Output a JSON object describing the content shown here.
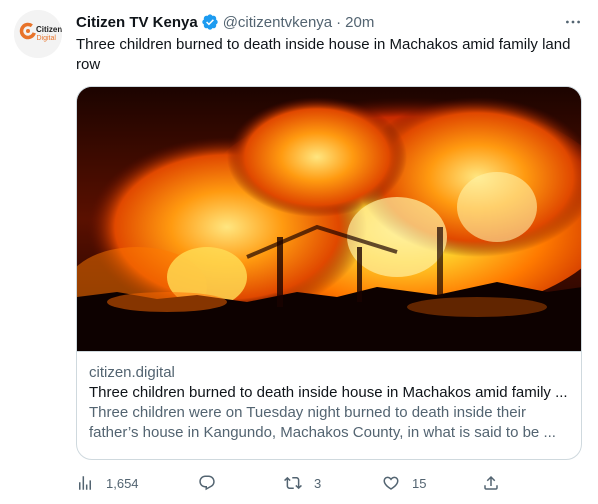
{
  "tweet": {
    "display_name": "Citizen TV Kenya",
    "handle": "@citizentvkenya",
    "separator": "·",
    "time": "20m",
    "text": "Three children burned to death inside house in Machakos amid family land row",
    "avatar": {
      "brand_text_line1": "Citizen",
      "brand_text_line2": "Digital",
      "brand_color": "#e8732a"
    },
    "verified_color": "#1d9bf0",
    "more_icon": "more-horizontal-icon"
  },
  "card": {
    "image_icon": "house-fire-photo",
    "domain": "citizen.digital",
    "title": "Three children burned to death inside house in Machakos amid family ...",
    "description": "Three children were on Tuesday night burned to death inside their father’s house in Kangundo, Machakos County, in what is said to be ..."
  },
  "actions": {
    "views": {
      "icon": "views-bar-chart-icon",
      "count": "1,654"
    },
    "reply": {
      "icon": "reply-bubble-icon",
      "count": ""
    },
    "retweet": {
      "icon": "retweet-icon",
      "count": "3"
    },
    "like": {
      "icon": "heart-icon",
      "count": "15"
    },
    "share": {
      "icon": "share-upload-icon",
      "count": ""
    }
  },
  "colors": {
    "text_primary": "#0f1419",
    "text_secondary": "#536471",
    "border": "#cfd9de"
  }
}
